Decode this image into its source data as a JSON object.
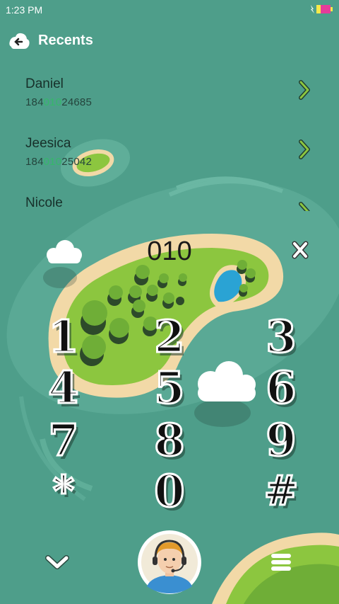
{
  "status_bar": {
    "time": "1:23 PM"
  },
  "header": {
    "title": "Recents",
    "back_icon": "back-arrow-icon"
  },
  "recents": [
    {
      "name": "Daniel",
      "number_pre": "184",
      "number_match": "010",
      "number_post": "24685"
    },
    {
      "name": "Jeesica",
      "number_pre": "184",
      "number_match": "010",
      "number_post": "25042"
    },
    {
      "name": "Nicole",
      "number_pre": "",
      "number_match": "",
      "number_post": ""
    }
  ],
  "dialer": {
    "display": "010",
    "keys": [
      "1",
      "2",
      "3",
      "4",
      "5",
      "6",
      "7",
      "8",
      "9",
      "*",
      "0",
      "#"
    ]
  },
  "bottom_bar": {
    "collapse_icon": "chevron-down-icon",
    "avatar_icon": "operator-avatar",
    "menu_icon": "menu-icon"
  },
  "colors": {
    "sea": "#4e9e8a",
    "sand": "#f2d9a7",
    "grass": "#8cc63f",
    "highlight": "#35b86a"
  }
}
